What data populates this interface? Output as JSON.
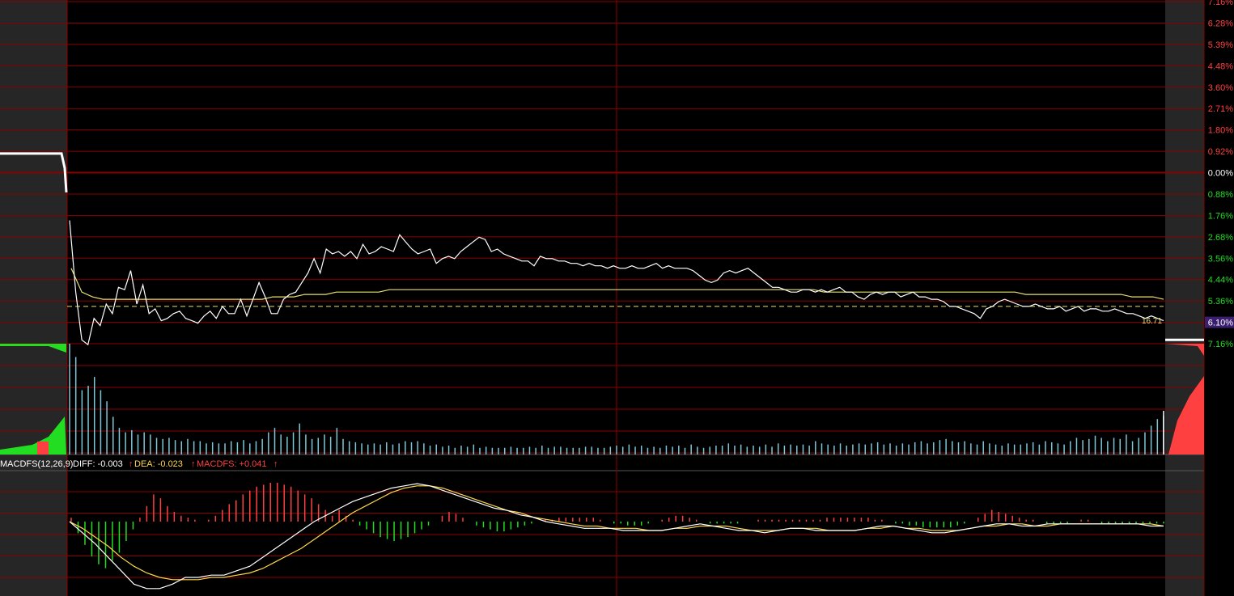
{
  "colors": {
    "background": "#000000",
    "grid": "#8b0000",
    "gray_panel": "#262626",
    "price_line": "#ffffff",
    "avg_line": "#e8e070",
    "dashed_line": "#e8e070",
    "up": "#ff4040",
    "down": "#22dd22",
    "volume_bar": "#7fc6d6",
    "neutral_label": "#ffffff",
    "dea": "#ffd84a",
    "highlight_bg": "#3a1f6e"
  },
  "chart_data": [
    {
      "type": "line",
      "name": "intraday-price-panel",
      "y_axis_percent_labels": [
        "7.16%",
        "6.28%",
        "5.39%",
        "4.48%",
        "3.60%",
        "2.71%",
        "1.80%",
        "0.92%",
        "0.00%",
        "0.88%",
        "1.76%",
        "2.68%",
        "3.56%",
        "4.44%",
        "5.36%",
        "6.10%",
        "7.16%"
      ],
      "y_axis_label_colors": [
        "up",
        "up",
        "up",
        "up",
        "up",
        "up",
        "up",
        "up",
        "neutral",
        "down",
        "down",
        "down",
        "down",
        "down",
        "down",
        "highlight",
        "down"
      ],
      "ylim_percent": [
        -7.16,
        7.16
      ],
      "reference_level_label": "16.71",
      "reference_level_percent": -5.6,
      "premarket_level_percent": 0.8,
      "price_percent": [
        -2.0,
        -5.0,
        -7.0,
        -7.2,
        -6.1,
        -6.4,
        -5.5,
        -5.9,
        -4.8,
        -4.9,
        -4.1,
        -5.5,
        -4.7,
        -5.9,
        -5.7,
        -6.2,
        -6.1,
        -5.9,
        -5.8,
        -6.1,
        -6.2,
        -6.3,
        -6.0,
        -5.8,
        -6.1,
        -5.6,
        -5.9,
        -5.9,
        -5.3,
        -6.0,
        -5.3,
        -4.6,
        -5.2,
        -5.9,
        -5.9,
        -5.3,
        -5.1,
        -5.0,
        -4.6,
        -4.2,
        -3.6,
        -4.2,
        -3.2,
        -3.4,
        -3.3,
        -3.5,
        -3.3,
        -3.6,
        -3.0,
        -3.4,
        -3.3,
        -3.1,
        -3.2,
        -3.3,
        -2.6,
        -2.9,
        -3.2,
        -3.4,
        -3.3,
        -3.2,
        -3.8,
        -3.6,
        -3.5,
        -3.6,
        -3.3,
        -3.1,
        -2.9,
        -2.7,
        -2.8,
        -3.3,
        -3.2,
        -3.4,
        -3.5,
        -3.6,
        -3.7,
        -3.7,
        -3.9,
        -3.5,
        -3.6,
        -3.6,
        -3.7,
        -3.7,
        -3.8,
        -3.8,
        -3.9,
        -3.8,
        -3.9,
        -3.9,
        -4.0,
        -3.9,
        -4.0,
        -4.0,
        -3.9,
        -4.0,
        -4.0,
        -3.9,
        -3.8,
        -4.0,
        -3.9,
        -4.0,
        -4.0,
        -4.0,
        -4.1,
        -4.3,
        -4.5,
        -4.6,
        -4.5,
        -4.2,
        -4.1,
        -4.2,
        -4.1,
        -4.0,
        -4.2,
        -4.4,
        -4.6,
        -4.8,
        -4.8,
        -4.9,
        -5.0,
        -5.0,
        -4.9,
        -4.9,
        -5.0,
        -4.9,
        -5.0,
        -4.9,
        -4.8,
        -5.0,
        -5.0,
        -5.2,
        -5.3,
        -5.1,
        -5.0,
        -5.1,
        -5.0,
        -5.0,
        -5.2,
        -5.1,
        -5.0,
        -5.2,
        -5.2,
        -5.3,
        -5.3,
        -5.4,
        -5.6,
        -5.6,
        -5.7,
        -5.8,
        -5.9,
        -6.1,
        -5.7,
        -5.6,
        -5.4,
        -5.3,
        -5.4,
        -5.5,
        -5.6,
        -5.6,
        -5.5,
        -5.6,
        -5.7,
        -5.7,
        -5.6,
        -5.8,
        -5.7,
        -5.6,
        -5.8,
        -5.7,
        -5.7,
        -5.8,
        -5.8,
        -5.7,
        -5.8,
        -5.9,
        -5.9,
        -6.0,
        -6.1,
        -6.0,
        -6.1,
        -6.2
      ],
      "avg_percent": [
        -4.0,
        -5.0,
        -5.2,
        -5.3,
        -5.3,
        -5.3,
        -5.3,
        -5.3,
        -5.3,
        -5.3,
        -5.3,
        -5.3,
        -5.3,
        -5.3,
        -5.3,
        -5.3,
        -5.3,
        -5.3,
        -5.3,
        -5.2,
        -5.2,
        -5.2,
        -5.1,
        -5.1,
        -5.1,
        -5.0,
        -5.0,
        -5.0,
        -5.0,
        -5.0,
        -4.9,
        -4.9,
        -4.9,
        -4.9,
        -4.9,
        -4.9,
        -4.9,
        -4.9,
        -4.9,
        -4.9,
        -4.9,
        -4.9,
        -4.9,
        -4.9,
        -4.9,
        -4.9,
        -4.9,
        -4.9,
        -4.9,
        -4.9,
        -4.9,
        -4.9,
        -4.9,
        -4.9,
        -4.9,
        -4.9,
        -4.9,
        -4.9,
        -4.9,
        -4.9,
        -4.9,
        -4.9,
        -4.9,
        -4.9,
        -4.9,
        -4.9,
        -4.9,
        -4.9,
        -4.9,
        -4.9,
        -4.9,
        -5.0,
        -5.0,
        -5.0,
        -5.0,
        -5.0,
        -5.0,
        -5.0,
        -5.0,
        -5.0,
        -5.0,
        -5.0,
        -5.0,
        -5.0,
        -5.0,
        -5.0,
        -5.0,
        -5.0,
        -5.0,
        -5.0,
        -5.1,
        -5.1,
        -5.1,
        -5.1,
        -5.1,
        -5.1,
        -5.1,
        -5.1,
        -5.1,
        -5.1,
        -5.2,
        -5.2,
        -5.2,
        -5.3
      ]
    },
    {
      "type": "bar",
      "name": "volume-panel",
      "values": [
        100,
        88,
        58,
        62,
        70,
        58,
        48,
        34,
        24,
        20,
        22,
        18,
        20,
        18,
        15,
        14,
        15,
        13,
        12,
        14,
        12,
        12,
        10,
        11,
        10,
        10,
        12,
        11,
        13,
        10,
        12,
        14,
        20,
        24,
        18,
        16,
        20,
        28,
        18,
        14,
        15,
        18,
        16,
        24,
        14,
        12,
        11,
        10,
        9,
        10,
        9,
        11,
        9,
        10,
        12,
        11,
        12,
        10,
        8,
        9,
        7,
        8,
        6,
        8,
        7,
        9,
        6,
        7,
        6,
        6,
        6,
        7,
        6,
        6,
        7,
        6,
        8,
        6,
        7,
        7,
        6,
        6,
        6,
        7,
        7,
        6,
        6,
        7,
        8,
        7,
        9,
        7,
        8,
        6,
        7,
        6,
        8,
        7,
        8,
        6,
        9,
        7,
        6,
        7,
        8,
        8,
        10,
        8,
        9,
        7,
        8,
        7,
        9,
        7,
        10,
        8,
        9,
        8,
        9,
        8,
        12,
        10,
        9,
        8,
        10,
        8,
        9,
        10,
        9,
        10,
        11,
        9,
        10,
        8,
        10,
        9,
        11,
        12,
        10,
        11,
        13,
        14,
        12,
        11,
        12,
        10,
        9,
        12,
        10,
        9,
        8,
        10,
        9,
        9,
        10,
        11,
        9,
        12,
        11,
        10,
        9,
        12,
        15,
        13,
        14,
        17,
        15,
        12,
        15,
        14,
        18,
        12,
        15,
        20,
        26,
        32,
        35
      ],
      "premarket_volume_hint": "red/green fill at left",
      "closing_auction_hint": "red fill at right"
    },
    {
      "type": "bar",
      "name": "macd-panel",
      "indicator_label": "MACDFS(12,26,9)",
      "diff_label": "DIFF: -0.003",
      "dea_label": "DEA: -0.023",
      "macd_label": "MACDFS: +0.041",
      "macd_hist": [
        0.2,
        -0.6,
        -1.2,
        -1.8,
        -2.2,
        -2.4,
        -2.0,
        -1.6,
        -1.0,
        -0.4,
        0.2,
        0.8,
        1.4,
        1.2,
        0.8,
        0.5,
        0.3,
        0.2,
        0.1,
        0.0,
        0.1,
        0.3,
        0.6,
        0.9,
        1.1,
        1.4,
        1.6,
        1.8,
        1.9,
        2.0,
        2.0,
        1.9,
        1.8,
        1.6,
        1.4,
        1.2,
        0.9,
        0.6,
        0.3,
        0.6,
        0.3,
        0.1,
        -0.2,
        -0.4,
        -0.6,
        -0.8,
        -0.9,
        -1.0,
        -0.9,
        -0.8,
        -0.6,
        -0.4,
        -0.2,
        0.0,
        0.3,
        0.5,
        0.4,
        0.2,
        0.0,
        -0.2,
        -0.3,
        -0.4,
        -0.5,
        -0.5,
        -0.4,
        -0.3,
        -0.2,
        -0.1,
        0.0,
        0.1,
        0.1,
        0.2,
        0.2,
        0.2,
        0.2,
        0.2,
        0.2,
        0.1,
        0.0,
        -0.1,
        -0.1,
        -0.2,
        -0.2,
        -0.2,
        -0.1,
        0.0,
        0.1,
        0.2,
        0.3,
        0.3,
        0.2,
        0.1,
        0.0,
        -0.1,
        -0.1,
        -0.1,
        -0.1,
        -0.1,
        0.0,
        0.0,
        0.1,
        0.1,
        0.1,
        0.1,
        0.1,
        0.1,
        0.1,
        0.1,
        0.1,
        0.1,
        0.2,
        0.2,
        0.2,
        0.2,
        0.2,
        0.2,
        0.2,
        0.1,
        0.1,
        0.0,
        -0.1,
        -0.1,
        -0.2,
        -0.2,
        -0.3,
        -0.3,
        -0.3,
        -0.3,
        -0.3,
        -0.2,
        -0.1,
        0.0,
        0.2,
        0.4,
        0.6,
        0.5,
        0.4,
        0.3,
        0.2,
        0.1,
        0.1,
        0.0,
        -0.1,
        -0.1,
        -0.1,
        -0.1,
        0.0,
        0.1,
        0.1,
        0.0,
        -0.1,
        -0.1,
        -0.1,
        -0.1,
        -0.1,
        -0.1,
        -0.1,
        -0.1,
        -0.1,
        -0.1
      ],
      "diff_line": [
        0.0,
        -0.5,
        -1.0,
        -1.6,
        -2.2,
        -2.8,
        -3.0,
        -3.0,
        -2.8,
        -2.5,
        -2.5,
        -2.4,
        -2.4,
        -2.2,
        -2.0,
        -1.6,
        -1.2,
        -0.8,
        -0.4,
        0.0,
        0.3,
        0.6,
        0.9,
        1.1,
        1.3,
        1.5,
        1.6,
        1.7,
        1.6,
        1.4,
        1.2,
        1.0,
        0.8,
        0.6,
        0.5,
        0.3,
        0.2,
        0.0,
        -0.1,
        -0.2,
        -0.3,
        -0.3,
        -0.3,
        -0.4,
        -0.4,
        -0.4,
        -0.4,
        -0.3,
        -0.2,
        -0.1,
        -0.2,
        -0.3,
        -0.4,
        -0.4,
        -0.5,
        -0.4,
        -0.3,
        -0.3,
        -0.4,
        -0.4,
        -0.4,
        -0.4,
        -0.3,
        -0.2,
        -0.2,
        -0.3,
        -0.4,
        -0.5,
        -0.5,
        -0.4,
        -0.3,
        -0.2,
        -0.1,
        -0.1,
        -0.2,
        -0.2,
        -0.1,
        -0.1,
        -0.1,
        -0.1,
        -0.1,
        -0.1,
        -0.1,
        -0.1,
        -0.2,
        -0.2
      ],
      "dea_line": [
        0.0,
        -0.3,
        -0.7,
        -1.1,
        -1.6,
        -2.0,
        -2.3,
        -2.5,
        -2.6,
        -2.6,
        -2.6,
        -2.5,
        -2.5,
        -2.4,
        -2.3,
        -2.1,
        -1.8,
        -1.5,
        -1.2,
        -0.8,
        -0.4,
        0.0,
        0.4,
        0.7,
        1.0,
        1.3,
        1.5,
        1.6,
        1.6,
        1.5,
        1.3,
        1.1,
        0.9,
        0.7,
        0.5,
        0.4,
        0.2,
        0.1,
        0.0,
        -0.1,
        -0.2,
        -0.2,
        -0.3,
        -0.3,
        -0.3,
        -0.4,
        -0.4,
        -0.3,
        -0.3,
        -0.2,
        -0.2,
        -0.2,
        -0.3,
        -0.4,
        -0.4,
        -0.4,
        -0.3,
        -0.3,
        -0.3,
        -0.4,
        -0.4,
        -0.4,
        -0.3,
        -0.3,
        -0.2,
        -0.3,
        -0.3,
        -0.4,
        -0.4,
        -0.4,
        -0.3,
        -0.2,
        -0.2,
        -0.1,
        -0.1,
        -0.2,
        -0.2,
        -0.1,
        -0.1,
        -0.1,
        -0.1,
        -0.1,
        -0.1,
        -0.1,
        -0.1,
        -0.2
      ]
    }
  ]
}
